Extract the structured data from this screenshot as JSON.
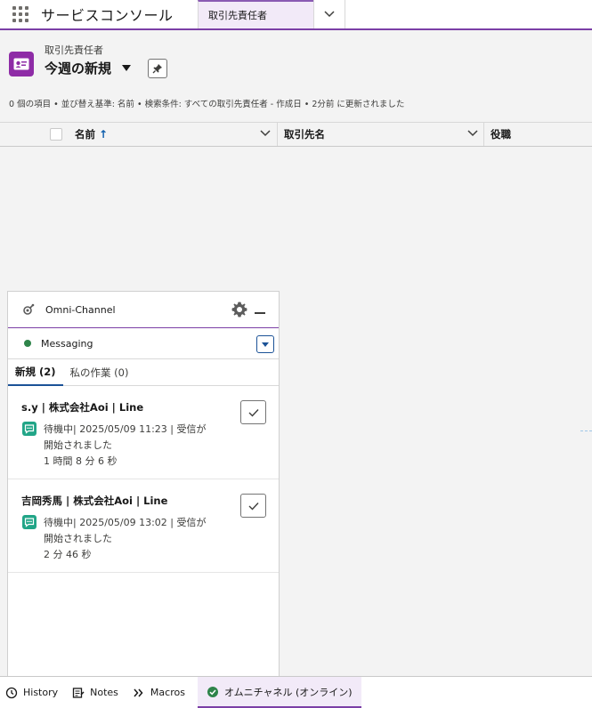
{
  "header": {
    "app_name": "サービスコンソール",
    "tab_label": "取引先責任者"
  },
  "list_view": {
    "object_label": "取引先責任者",
    "view_name": "今週の新規",
    "meta": "0 個の項目 • 並び替え基準: 名前 • 検索条件: すべての取引先責任者 - 作成日 • 2分前 に更新されました",
    "columns": [
      "名前",
      "取引先名",
      "役職"
    ],
    "sort_indicator": "↑"
  },
  "omni": {
    "title": "Omni-Channel",
    "status": "Messaging",
    "status_color": "#2e844a",
    "tabs": [
      {
        "label": "新規 (2)",
        "active": true
      },
      {
        "label": "私の作業 (0)",
        "active": false
      }
    ],
    "work_items": [
      {
        "title": "s.y | 株式会社Aoi | Line",
        "line1": "待機中| 2025/05/09 11:23 | 受信が",
        "line2": "開始されました",
        "line3": "1 時間 8 分 6 秒"
      },
      {
        "title": "吉岡秀馬 | 株式会社Aoi | Line",
        "line1": "待機中| 2025/05/09 13:02 | 受信が",
        "line2": "開始されました",
        "line3": "2 分 46 秒"
      }
    ]
  },
  "utility_bar": {
    "items": [
      {
        "label": "History",
        "icon": "clock-icon"
      },
      {
        "label": "Notes",
        "icon": "notes-icon"
      },
      {
        "label": "Macros",
        "icon": "macros-icon"
      },
      {
        "label": "オムニチャネル (オンライン)",
        "icon": "check-circle-icon"
      }
    ]
  },
  "colors": {
    "accent": "#7b3fa6",
    "object_icon": "#8e2ca6",
    "chat_icon": "#21a587"
  }
}
